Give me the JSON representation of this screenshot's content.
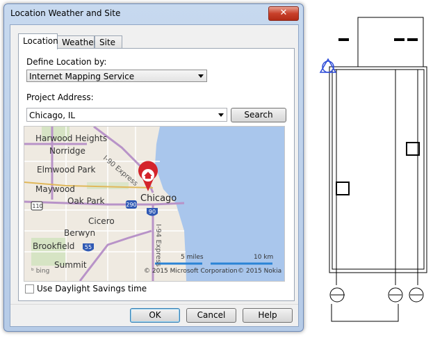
{
  "dialog": {
    "title": "Location Weather and Site",
    "close_label": "✕",
    "tabs": [
      {
        "label": "Location"
      },
      {
        "label": "Weather"
      },
      {
        "label": "Site"
      }
    ],
    "define_location_label": "Define Location by:",
    "define_location_value": "Internet Mapping Service",
    "project_address_label": "Project Address:",
    "project_address_value": "Chicago, IL",
    "search_label": "Search",
    "daylight_savings_label": "Use Daylight Savings time",
    "daylight_savings_checked": false,
    "ok_label": "OK",
    "cancel_label": "Cancel",
    "help_label": "Help"
  },
  "map": {
    "places": [
      "Harwood Heights",
      "Norridge",
      "Elmwood Park",
      "Maywood",
      "Oak Park",
      "Chicago",
      "Cicero",
      "Berwyn",
      "Brookfield",
      "Summit"
    ],
    "roads": [
      "I-90 Express",
      "I-94 Express"
    ],
    "shields": [
      "110",
      "290",
      "90",
      "55"
    ],
    "scale_miles": "5 miles",
    "scale_km": "10 km",
    "copyright_ms": "© 2015 Microsoft Corporation",
    "copyright_nokia": "© 2015 Nokia",
    "logo": "bing",
    "colors": {
      "water": "#a9c6ec",
      "land": "#efeae1",
      "highway": "#b893c8",
      "pin": "#d4242b"
    }
  }
}
